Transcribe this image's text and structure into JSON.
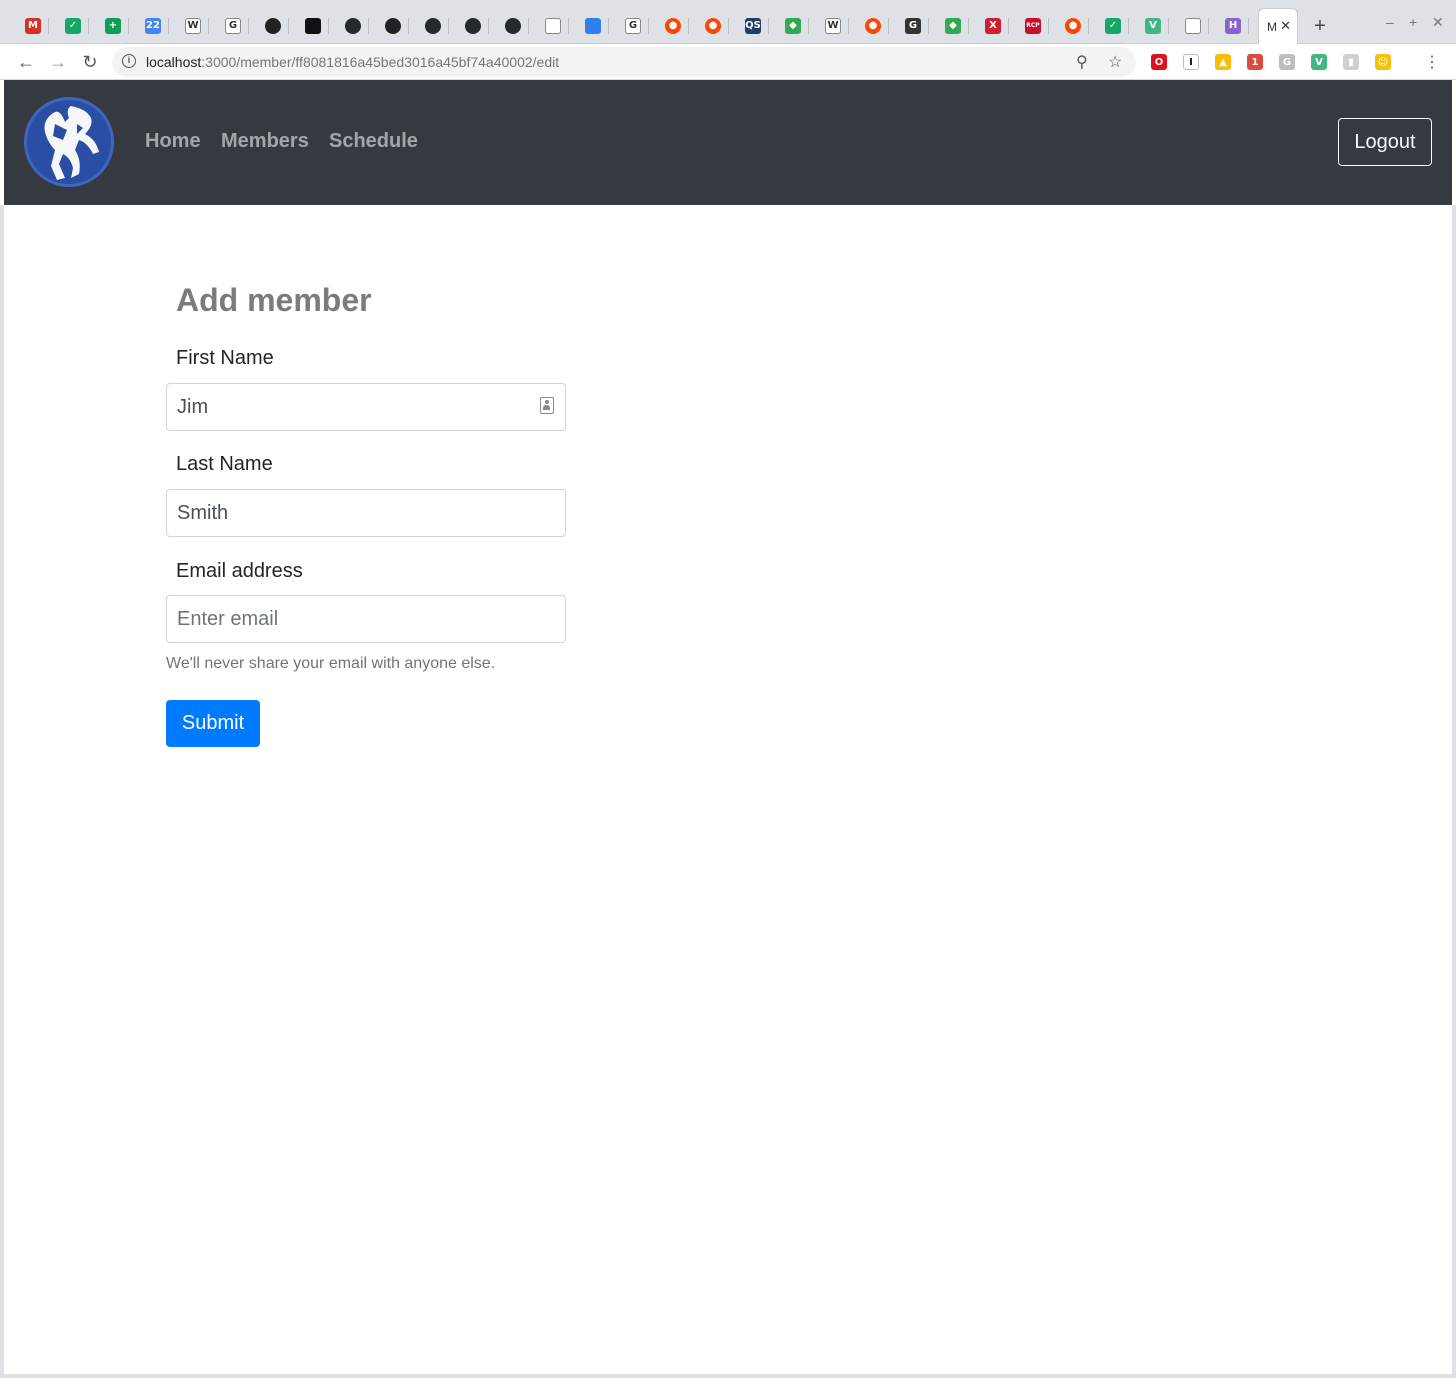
{
  "browser": {
    "tabs": [
      {
        "icon": "gmail-icon",
        "glyph": "M",
        "color": "#d93025"
      },
      {
        "icon": "hexagon-check-icon",
        "glyph": "✓",
        "color": "#16a765"
      },
      {
        "icon": "sheets-icon",
        "glyph": "+",
        "color": "#0f9d58"
      },
      {
        "icon": "calendar-icon",
        "glyph": "22",
        "color": "#4285f4"
      },
      {
        "icon": "wikipedia-icon",
        "glyph": "W",
        "color": "#ffffff"
      },
      {
        "icon": "google-icon",
        "glyph": "G",
        "color": "#ffffff"
      },
      {
        "icon": "circle-app-icon",
        "glyph": "",
        "color": "#222222"
      },
      {
        "icon": "square-app-icon",
        "glyph": "",
        "color": "#111111"
      },
      {
        "icon": "github-icon",
        "glyph": "",
        "color": "#24292e"
      },
      {
        "icon": "circle-app-icon",
        "glyph": "",
        "color": "#222222"
      },
      {
        "icon": "github-icon",
        "glyph": "",
        "color": "#24292e"
      },
      {
        "icon": "github-icon",
        "glyph": "",
        "color": "#24292e"
      },
      {
        "icon": "github-icon",
        "glyph": "",
        "color": "#24292e"
      },
      {
        "icon": "document-icon",
        "glyph": "",
        "color": "#ffffff"
      },
      {
        "icon": "shield-blue-icon",
        "glyph": "",
        "color": "#2f80ed"
      },
      {
        "icon": "google-icon",
        "glyph": "G",
        "color": "#ffffff"
      },
      {
        "icon": "reddit-icon",
        "glyph": "●",
        "color": "#ff4500"
      },
      {
        "icon": "reddit-icon",
        "glyph": "●",
        "color": "#ff4500"
      },
      {
        "icon": "qs-icon",
        "glyph": "QS",
        "color": "#1f3c6b"
      },
      {
        "icon": "maps-icon",
        "glyph": "◆",
        "color": "#34a853"
      },
      {
        "icon": "wikipedia-icon",
        "glyph": "W",
        "color": "#ffffff"
      },
      {
        "icon": "reddit-icon",
        "glyph": "●",
        "color": "#ff4500"
      },
      {
        "icon": "g-dark-icon",
        "glyph": "G",
        "color": "#333333"
      },
      {
        "icon": "maps-icon",
        "glyph": "◆",
        "color": "#34a853"
      },
      {
        "icon": "x-red-icon",
        "glyph": "X",
        "color": "#d0202f"
      },
      {
        "icon": "rcp-icon",
        "glyph": "RCP",
        "color": "#c8102e"
      },
      {
        "icon": "reddit-icon",
        "glyph": "●",
        "color": "#ff4500"
      },
      {
        "icon": "hexagon-check-icon",
        "glyph": "✓",
        "color": "#16a765"
      },
      {
        "icon": "vue-icon",
        "glyph": "V",
        "color": "#41b883"
      },
      {
        "icon": "document-icon",
        "glyph": "",
        "color": "#ffffff"
      },
      {
        "icon": "h-purple-icon",
        "glyph": "H",
        "color": "#8a63d2"
      }
    ],
    "active_tab": {
      "title": "M",
      "close": "✕"
    },
    "new_tab": "+",
    "window_controls": {
      "minimize": "–",
      "maximize": "+",
      "close": "✕"
    },
    "url_host": "localhost",
    "url_path": ":3000/member/ff8081816a45bed3016a45bf74a40002/edit",
    "extensions": [
      {
        "icon": "opera-icon",
        "glyph": "O",
        "color": "#e0101e"
      },
      {
        "icon": "instapaper-icon",
        "glyph": "I",
        "color": "#ffffff"
      },
      {
        "icon": "drive-icon",
        "glyph": "▲",
        "color": "#fbbc04"
      },
      {
        "icon": "todoist-icon",
        "glyph": "1",
        "color": "#db4c3f"
      },
      {
        "icon": "grammar-icon",
        "glyph": "G",
        "color": "#bdbdbd"
      },
      {
        "icon": "vue-devtools-icon",
        "glyph": "V",
        "color": "#41b883"
      },
      {
        "icon": "puzzle-icon",
        "glyph": "▮",
        "color": "#cfcfcf"
      },
      {
        "icon": "emoji-icon",
        "glyph": "☺",
        "color": "#f4c20d"
      }
    ]
  },
  "navbar": {
    "links": [
      "Home",
      "Members",
      "Schedule"
    ],
    "logout": "Logout"
  },
  "form": {
    "title": "Add member",
    "first_name_label": "First Name",
    "first_name_value": "Jim",
    "last_name_label": "Last Name",
    "last_name_value": "Smith",
    "email_label": "Email address",
    "email_value": "",
    "email_placeholder": "Enter email",
    "email_help": "We'll never share your email with anyone else.",
    "submit": "Submit"
  }
}
